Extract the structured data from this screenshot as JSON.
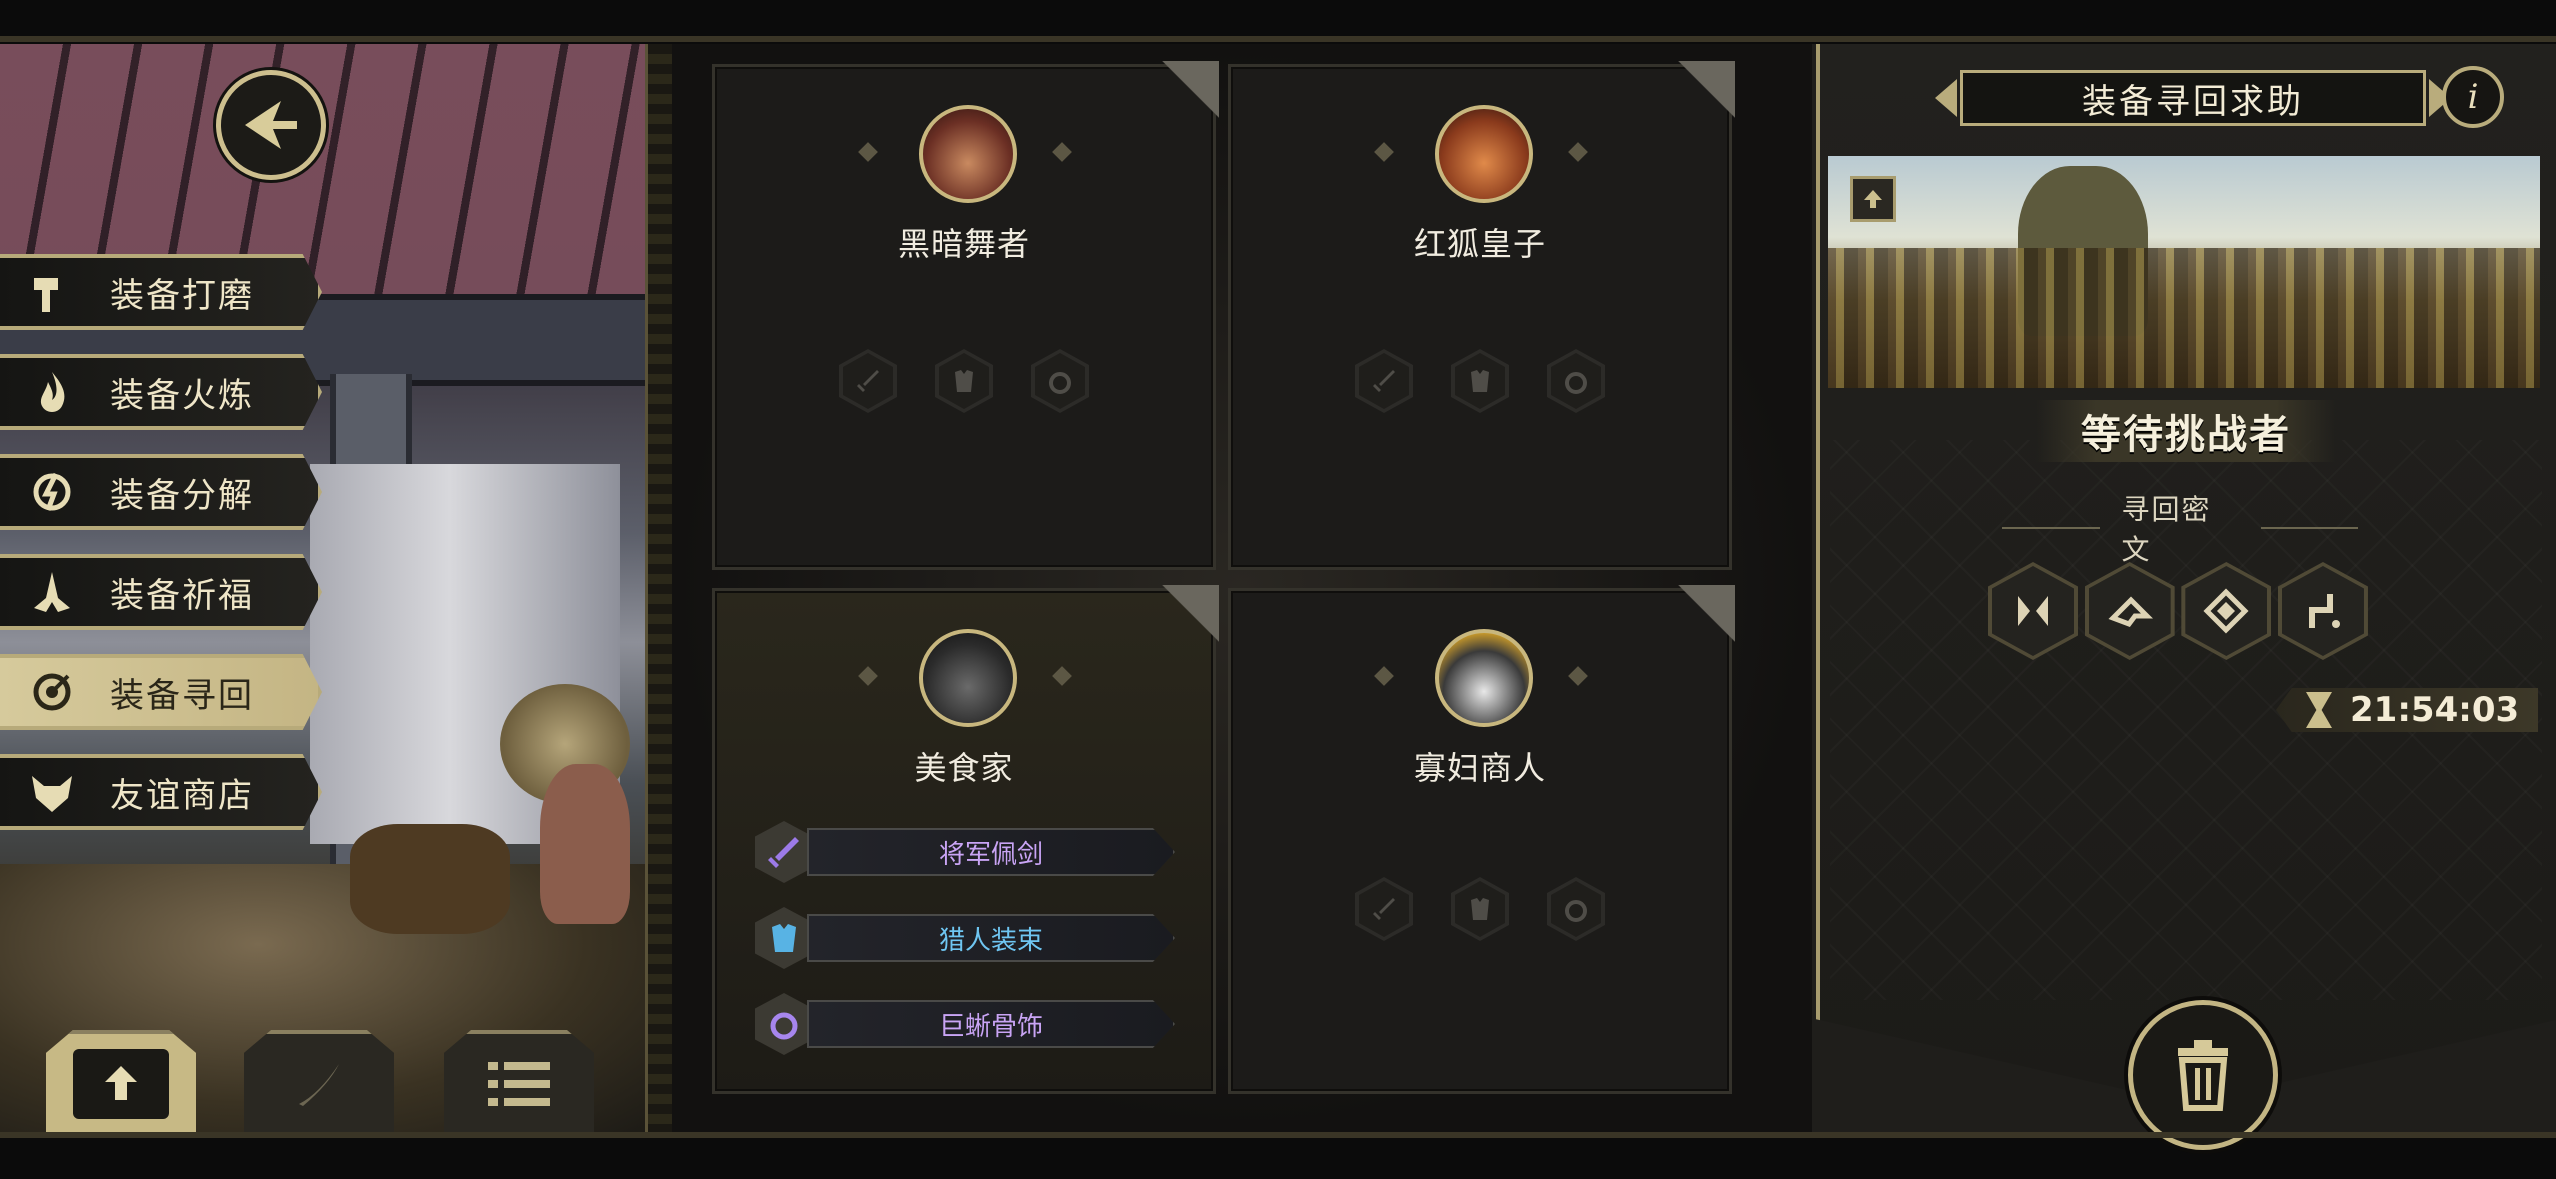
{
  "menu": {
    "items": [
      {
        "label": "装备打磨",
        "icon": "hammer-icon"
      },
      {
        "label": "装备火炼",
        "icon": "flame-icon"
      },
      {
        "label": "装备分解",
        "icon": "disassemble-icon"
      },
      {
        "label": "装备祈福",
        "icon": "pray-hands-icon"
      },
      {
        "label": "装备寻回",
        "icon": "target-icon",
        "active": true
      },
      {
        "label": "友谊商店",
        "icon": "fox-icon"
      }
    ]
  },
  "characters": [
    {
      "name": "黑暗舞者",
      "portrait": "rat-dancer-portrait"
    },
    {
      "name": "红狐皇子",
      "portrait": "red-fox-prince-portrait"
    },
    {
      "name": "美食家",
      "portrait": "gourmet-portrait",
      "equipment": [
        {
          "name": "将军佩剑",
          "icon": "sword-icon",
          "color": "#c9a4f5"
        },
        {
          "name": "猎人装束",
          "icon": "armor-icon",
          "color": "#6fc6f2"
        },
        {
          "name": "巨蜥骨饰",
          "icon": "ring-icon",
          "color": "#c9a4f5"
        }
      ]
    },
    {
      "name": "寡妇商人",
      "portrait": "widow-merchant-portrait"
    }
  ],
  "right_panel": {
    "title": "装备寻回求助",
    "status": "等待挑战者",
    "cipher_label": "寻回密文",
    "ciphers": [
      "rune-1-icon",
      "rune-2-icon",
      "rune-3-icon",
      "rune-4-icon"
    ],
    "timer": "21:54:03"
  },
  "colors": {
    "gold_border": "#b9ac7c",
    "panel_bg": "#1f1e1b",
    "epic_purple": "#c9a4f5",
    "rare_blue": "#6fc6f2"
  }
}
